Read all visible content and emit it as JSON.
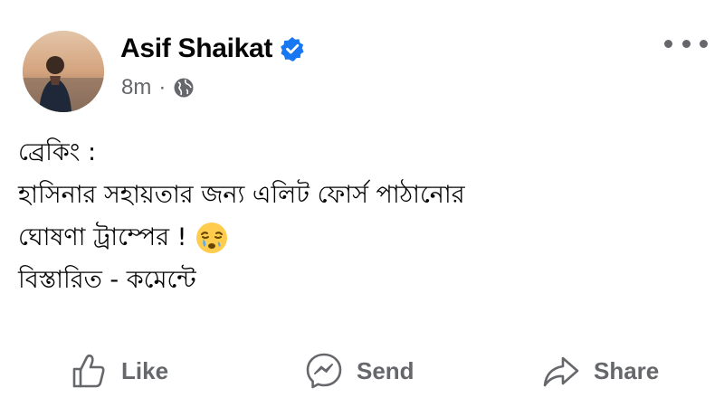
{
  "post": {
    "author": "Asif Shaikat",
    "verified_icon": "verified-badge-icon",
    "time": "8m",
    "separator": "·",
    "privacy_icon": "globe-icon",
    "more_icon": "more-options-icon",
    "content_lines": [
      "ব্রেকিং :",
      "হাসিনার সহায়তার জন্য এলিট ফোর্স পাঠানোর",
      "ঘোষণা ট্রাম্পের !",
      "বিস্তারিত - কমেন্টে"
    ],
    "emoji_icon": "crying-face-emoji-icon"
  },
  "actions": {
    "like": {
      "label": "Like",
      "icon": "thumbs-up-icon"
    },
    "send": {
      "label": "Send",
      "icon": "messenger-icon"
    },
    "share": {
      "label": "Share",
      "icon": "share-arrow-icon"
    }
  },
  "colors": {
    "verified": "#1877f2",
    "secondary_text": "#65676b",
    "primary_text": "#050505"
  }
}
